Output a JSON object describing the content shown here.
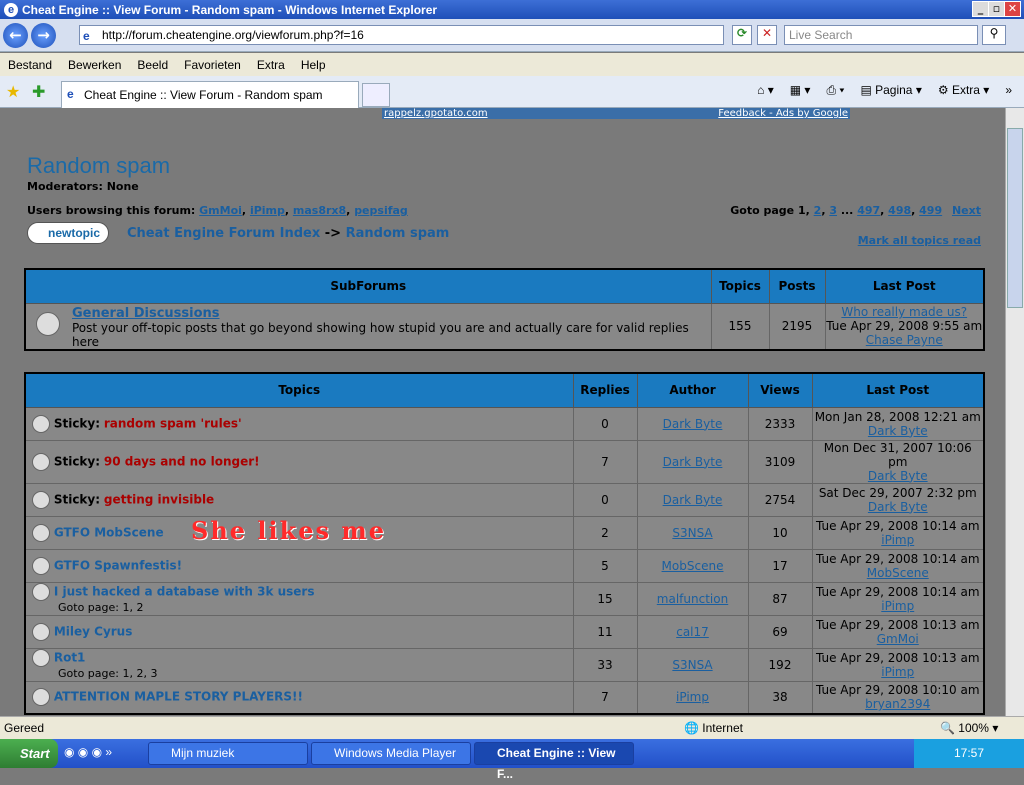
{
  "window": {
    "title": "Cheat Engine :: View Forum - Random spam - Windows Internet Explorer"
  },
  "browser": {
    "url": "http://forum.cheatengine.org/viewforum.php?f=16",
    "search_placeholder": "Live Search",
    "menu": [
      "Bestand",
      "Bewerken",
      "Beeld",
      "Favorieten",
      "Extra",
      "Help"
    ],
    "tab_title": "Cheat Engine :: View Forum - Random spam",
    "tools": {
      "page": "Pagina",
      "extra": "Extra"
    }
  },
  "ad": {
    "left": "rappelz.gpotato.com",
    "right": "Feedback - Ads by Google"
  },
  "forum": {
    "title": "Random spam",
    "moderators": "Moderators: None",
    "browsing_label": "Users browsing this forum:",
    "browsing_users": [
      "GmMoi",
      "iPimp",
      "mas8rx8",
      "pepsifag"
    ],
    "goto": {
      "label": "Goto page",
      "current": "1",
      "pages": [
        "2",
        "3",
        "497",
        "498",
        "499"
      ],
      "next": "Next"
    },
    "newtopic": "newtopic",
    "breadcrumb": {
      "index": "Cheat Engine Forum Index",
      "sep": "->",
      "current": "Random spam"
    },
    "mark_read": "Mark all topics read"
  },
  "subforums": {
    "headers": [
      "SubForums",
      "Topics",
      "Posts",
      "Last Post"
    ],
    "rows": [
      {
        "name": "General Discussions",
        "desc": "Post your off-topic posts that go beyond showing how stupid you are and actually care for valid replies here",
        "topics": "155",
        "posts": "2195",
        "last_title": "Who really made us?",
        "last_date": "Tue Apr 29, 2008 9:55 am",
        "last_user": "Chase Payne"
      }
    ]
  },
  "topics": {
    "headers": [
      "Topics",
      "Replies",
      "Author",
      "Views",
      "Last Post"
    ],
    "rows": [
      {
        "prefix": "Sticky:",
        "title": "random spam 'rules'",
        "hot": true,
        "replies": "0",
        "author": "Dark Byte",
        "views": "2333",
        "date": "Mon Jan 28, 2008 12:21 am",
        "user": "Dark Byte"
      },
      {
        "prefix": "Sticky:",
        "title": "90 days and no longer!",
        "hot": true,
        "replies": "7",
        "author": "Dark Byte",
        "views": "3109",
        "date": "Mon Dec 31, 2007 10:06 pm",
        "user": "Dark Byte"
      },
      {
        "prefix": "Sticky:",
        "title": "getting invisible",
        "hot": true,
        "replies": "0",
        "author": "Dark Byte",
        "views": "2754",
        "date": "Sat Dec 29, 2007 2:32 pm",
        "user": "Dark Byte"
      },
      {
        "prefix": "",
        "title": "GTFO MobScene",
        "hot": false,
        "replies": "2",
        "author": "S3NSA",
        "views": "10",
        "date": "Tue Apr 29, 2008 10:14 am",
        "user": "iPimp"
      },
      {
        "prefix": "",
        "title": "GTFO Spawnfestis!",
        "hot": false,
        "replies": "5",
        "author": "MobScene",
        "views": "17",
        "date": "Tue Apr 29, 2008 10:14 am",
        "user": "MobScene"
      },
      {
        "prefix": "",
        "title": "I just hacked a database with 3k users",
        "hot": false,
        "replies": "15",
        "author": "malfunction",
        "views": "87",
        "date": "Tue Apr 29, 2008 10:14 am",
        "user": "iPimp",
        "goto": "Goto page: 1, 2"
      },
      {
        "prefix": "",
        "title": "Miley Cyrus",
        "hot": false,
        "replies": "11",
        "author": "cal17",
        "views": "69",
        "date": "Tue Apr 29, 2008 10:13 am",
        "user": "GmMoi"
      },
      {
        "prefix": "",
        "title": "Rot1",
        "hot": false,
        "replies": "33",
        "author": "S3NSA",
        "views": "192",
        "date": "Tue Apr 29, 2008 10:13 am",
        "user": "iPimp",
        "goto": "Goto page: 1, 2, 3"
      },
      {
        "prefix": "",
        "title": "ATTENTION MAPLE STORY PLAYERS!!",
        "hot": false,
        "replies": "7",
        "author": "iPimp",
        "views": "38",
        "date": "Tue Apr 29, 2008 10:10 am",
        "user": "bryan2394"
      }
    ],
    "partial_date": "Tue Apr 29, 2008 10:10 am"
  },
  "overlay_text": "She likes me",
  "status": {
    "text": "Gereed",
    "zone": "Internet",
    "zoom": "100%"
  },
  "taskbar": {
    "start": "Start",
    "tasks": [
      "Mijn muziek",
      "Windows Media Player",
      "Cheat Engine :: View F..."
    ],
    "time": "17:57"
  }
}
